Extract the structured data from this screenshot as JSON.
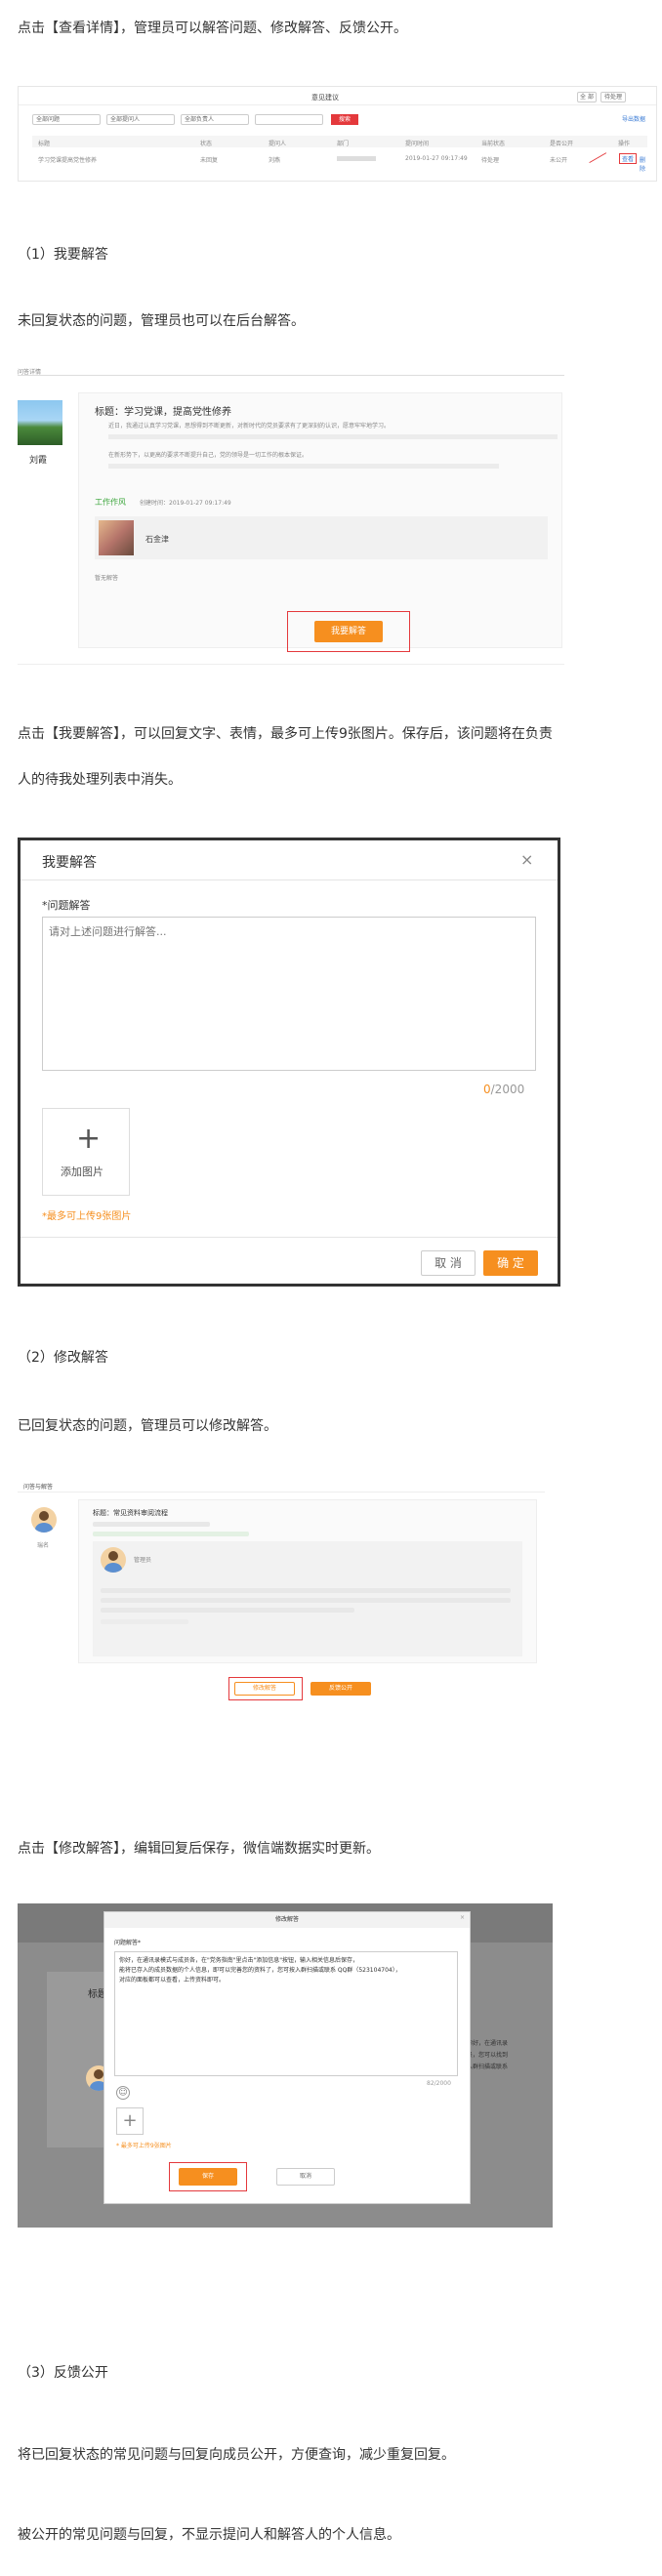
{
  "paragraphs": {
    "p1": "点击【查看详情】，管理员可以解答问题、修改解答、反馈公开。",
    "s1": "（1）我要解答",
    "p2": "未回复状态的问题，管理员也可以在后台解答。",
    "p3a": "点击【我要解答】，可以回复文字、表情，最多可上传9张图片。保存后，该问题将在负责",
    "p3b": "人的待我处理列表中消失。",
    "s2": "（2）修改解答",
    "p4": "已回复状态的问题，管理员可以修改解答。",
    "p5": "点击【修改解答】，编辑回复后保存，微信端数据实时更新。",
    "s3": "（3）反馈公开",
    "p6": "将已回复状态的常见问题与回复向成员公开，方便查询，减少重复回复。",
    "p7": "被公开的常见问题与回复，不显示提问人和解答人的个人信息。"
  },
  "shot1": {
    "title": "意见建议",
    "filters": [
      "全部问题",
      "全部提问人",
      "全部负责人"
    ],
    "search_button": "搜索",
    "top_buttons": [
      "全 部",
      "待处理"
    ],
    "right_link": "导出数据",
    "headers": [
      "标题",
      "状态",
      "提问人",
      "部门",
      "提问时间",
      "当前状态",
      "是否公开",
      "操作"
    ],
    "row": {
      "title": "学习党课提高党性修养",
      "status": "未回复",
      "asker": "刘燕",
      "time": "2019-01-27 09:17:49",
      "state": "待处理",
      "public": "未公开",
      "action_view": "查看",
      "action_delete": "删除"
    }
  },
  "shot2": {
    "header": "问答详情",
    "user_name": "刘霞",
    "q_title": "标题：学习党课，提高党性修养",
    "body_lines": [
      "近日，我通过认真学习党课，思想得到不断更新，对新时代的党员要求有了更深刻的认识，愿意牢牢地学习。",
      "在新形势下，以更高的要求不断提升自己，党的领导是一切工作的根本保证。"
    ],
    "tag": "工作作风",
    "created": "创建时间：2019-01-27 09:17:49",
    "responder": "石金津",
    "no_answer": "暂无解答",
    "answer_button": "我要解答"
  },
  "shot3": {
    "title": "我要解答",
    "close": "×",
    "field_label": "*问题解答",
    "placeholder": "请对上述问题进行解答...",
    "count_current": "0",
    "count_max": "/2000",
    "upload_label": "添加图片",
    "upload_hint": "*最多可上传9张图片",
    "cancel": "取 消",
    "confirm": "确 定"
  },
  "shot4": {
    "header": "问答与解答",
    "user_name": "瑞名",
    "q_title": "标题：常见资料审阅流程",
    "answerer": "管理员",
    "edit_button": "修改解答",
    "public_button": "反馈公开"
  },
  "shot5": {
    "modal_title": "修改解答",
    "field_label": "问题解答*",
    "text_lines": [
      "你好，在通讯录模式与成员各，在\"党务指南\"里点击\"添加信息\"按钮，输入相关信息后保存，",
      "能将已存入的成员数据的个人信息，即可以完善您的资料了，您可按入群扫描或联系 QQ群（523104704），",
      "对应的面板都可以查看，上传资料即可。"
    ],
    "count": "82/2000",
    "upload_hint": "* 最多可上传9张图片",
    "save": "保存",
    "cancel": "取消",
    "bg_title": "标题：常见资",
    "bg_side_lines": [
      "你好，在通讯录",
      "员，您可以找到",
      "入群扫描或联系"
    ]
  },
  "colors": {
    "accent_orange": "#f68f1f",
    "highlight_red": "#e4393c",
    "tag_green": "#3aa53a"
  }
}
